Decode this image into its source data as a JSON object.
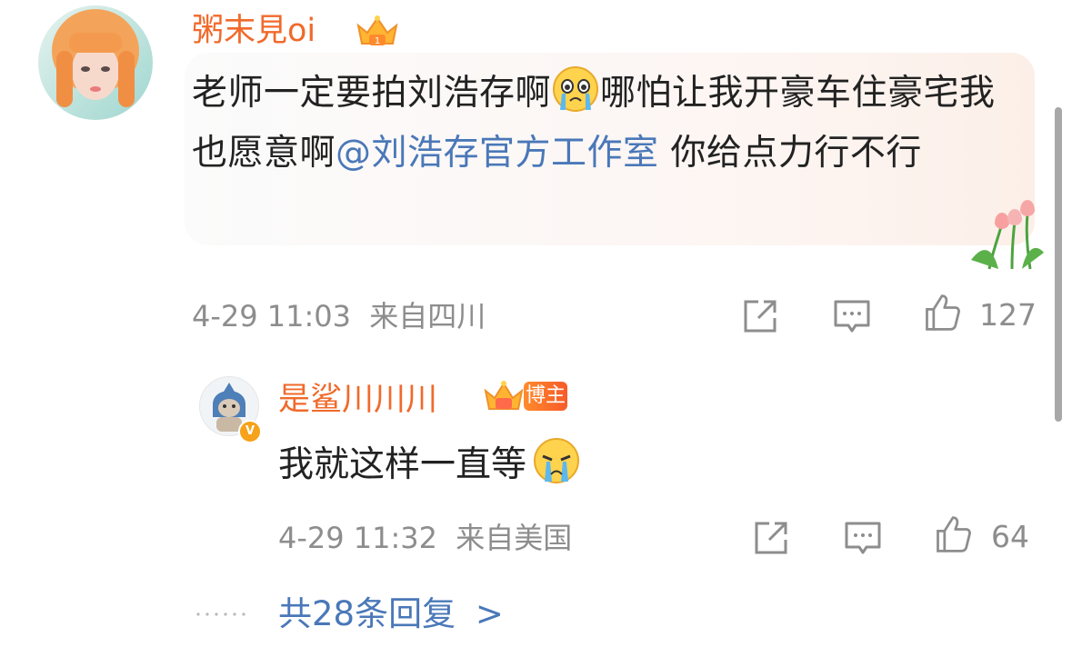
{
  "comment": {
    "username": "粥末見oi",
    "text_before": "老师一定要拍刘浩存啊",
    "text_after": "哪怕让我开豪车住豪宅我也愿意啊",
    "mention": "@刘浩存官方工作室",
    "text_end": " 你给点力行不行",
    "timestamp": "4-29 11:03",
    "location": "来自四川",
    "like_count": "127"
  },
  "reply": {
    "username": "是鲨川川川",
    "badge_text": "博主",
    "verified_mark": "V",
    "text": "我就这样一直等",
    "timestamp": "4-29 11:32",
    "location": "来自美国",
    "like_count": "64"
  },
  "more_replies": {
    "label": "共28条回复",
    "chevron": ">"
  },
  "icons": [
    "share-icon",
    "comment-icon",
    "like-icon",
    "crying-emoji-icon",
    "sobbing-emoji-icon",
    "crown-badge-icon",
    "tulip-decoration-icon"
  ],
  "colors": {
    "username": "#f06a2b",
    "mention": "#4a78b8",
    "meta": "#8d8d8d",
    "badge": "#f75b2a"
  }
}
